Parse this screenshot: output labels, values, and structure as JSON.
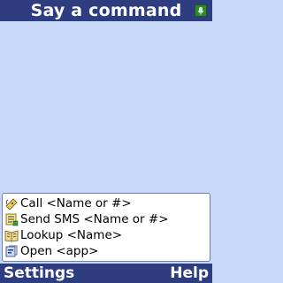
{
  "header": {
    "title": "Say a command",
    "icon": "speech-recognition-icon"
  },
  "commands": [
    {
      "label": "Call <Name or #>",
      "icon": "call-icon"
    },
    {
      "label": "Send SMS <Name or #>",
      "icon": "sms-icon"
    },
    {
      "label": "Lookup <Name>",
      "icon": "lookup-icon"
    },
    {
      "label": "Open <app>",
      "icon": "open-app-icon"
    }
  ],
  "softkeys": {
    "left": "Settings",
    "right": "Help"
  },
  "colors": {
    "bar": "#2e3c80",
    "background": "#c8d8f8",
    "list_background": "#ffffff",
    "icon_green": "#2f8a2f"
  }
}
